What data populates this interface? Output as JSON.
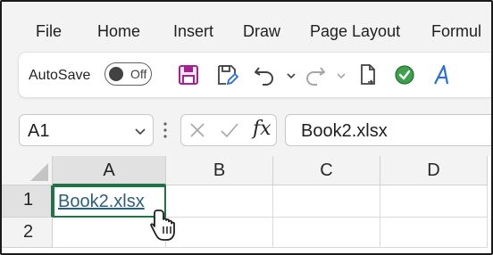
{
  "menu": {
    "items": [
      "File",
      "Home",
      "Insert",
      "Draw",
      "Page Layout",
      "Formul"
    ]
  },
  "ribbon": {
    "autosave_label": "AutoSave",
    "autosave_state": "Off",
    "icons": [
      "save-icon",
      "save-as-icon",
      "undo-icon",
      "redo-icon",
      "new-file-icon",
      "checker-icon",
      "text-effects-icon"
    ],
    "colors": {
      "save": "#a4238f",
      "checker": "#3ba14a",
      "text_effects": "#2b6fd6"
    }
  },
  "formula_bar": {
    "name_box": "A1",
    "formula": "Book2.xlsx",
    "fx_label": "fx"
  },
  "grid": {
    "columns": [
      "A",
      "B",
      "C",
      "D"
    ],
    "rows": [
      "1",
      "2"
    ],
    "cells": {
      "A1": "Book2.xlsx"
    },
    "active_cell": "A1",
    "accent_color": "#217346",
    "hyperlink_color": "#2e5f78"
  }
}
